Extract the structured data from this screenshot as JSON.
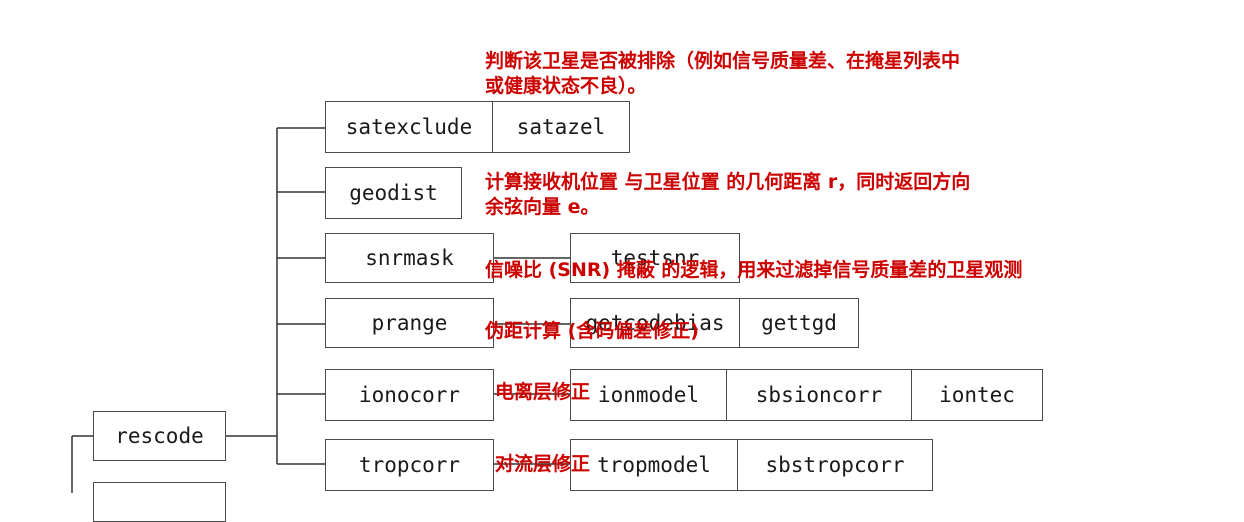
{
  "nodes": {
    "rescode": "rescode",
    "satexclude": "satexclude",
    "satazel": "satazel",
    "geodist": "geodist",
    "snrmask": "snrmask",
    "testsnr": "testsnr",
    "prange": "prange",
    "gettgd_partial": "getcodebias",
    "gettgd": "gettgd",
    "ionocorr": "ionocorr",
    "ionmodel": "ionmodel",
    "sbsioncorr": "sbsioncorr",
    "iontec": "iontec",
    "tropcorr": "tropcorr",
    "tropmodel": "tropmodel",
    "sbstropcorr": "sbstropcorr"
  },
  "annotations": {
    "satexclude_line1": "判断该卫星是否被排除（例如信号质量差、在掩星列表中",
    "satexclude_line2": "或健康状态不良）。",
    "geodist_line1": "计算接收机位置 与卫星位置 的几何距离 r，同时返回方向",
    "geodist_line2": "余弦向量 e。",
    "snrmask": "信噪比 (SNR) 掩蔽 的逻辑，用来过滤掉信号质量差的卫星观测",
    "prange": "伪距计算 (含码偏差修正)",
    "ionocorr": "电离层修正",
    "tropcorr": "对流层修正"
  }
}
